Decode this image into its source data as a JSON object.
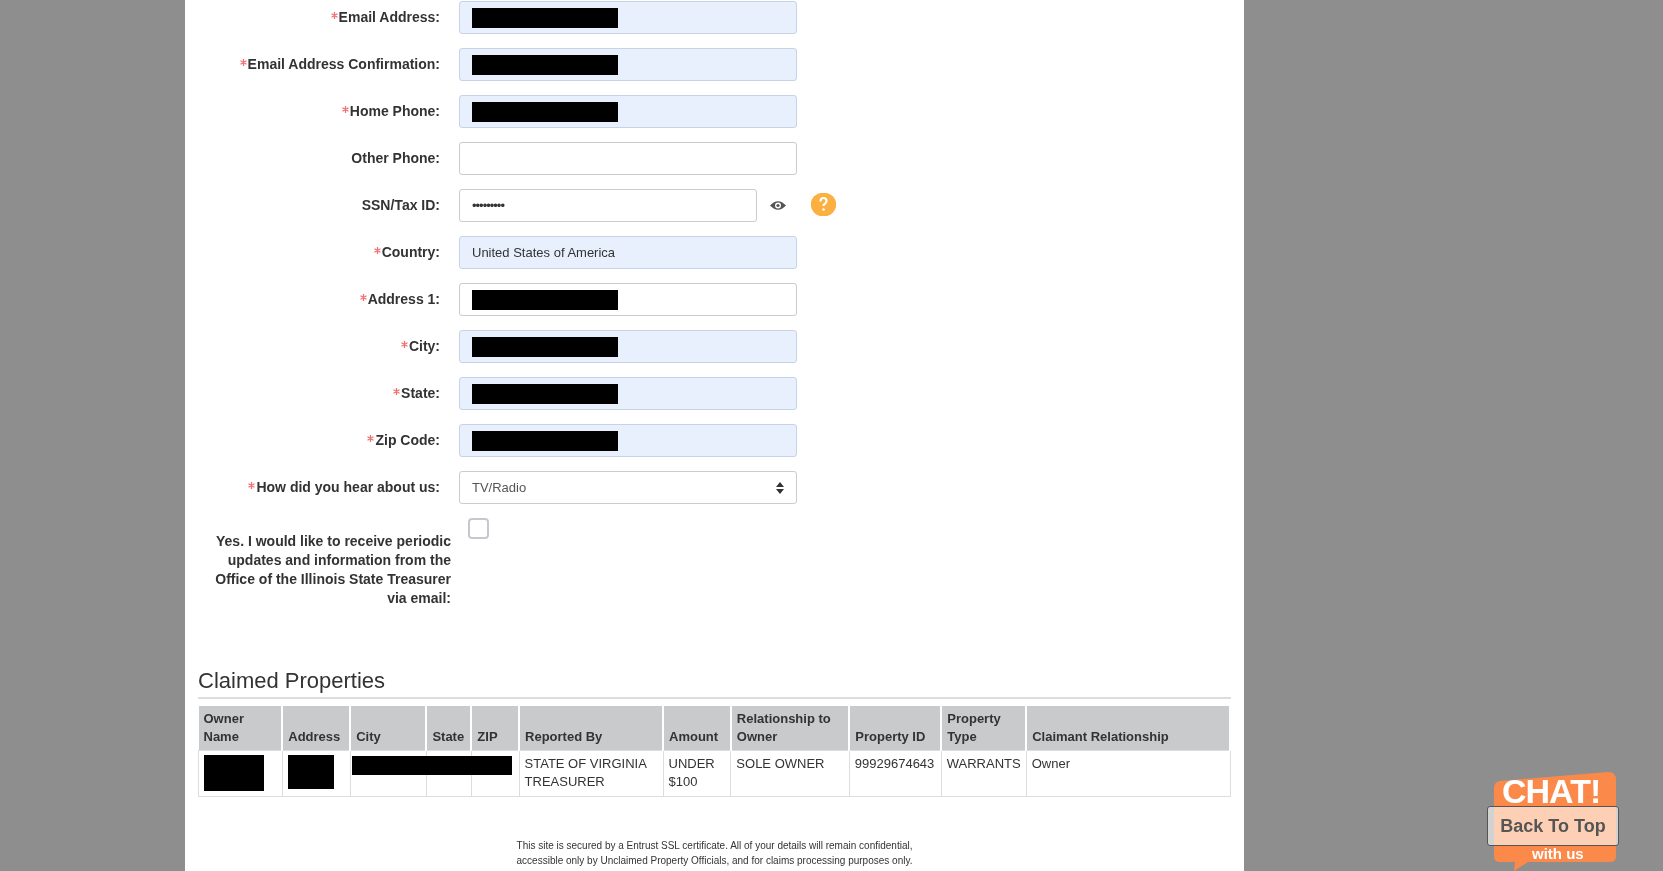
{
  "form": {
    "fields": [
      {
        "label": "Email Address:",
        "required": true,
        "kind": "text",
        "autofilled": true,
        "redacted": true
      },
      {
        "label": "Email Address Confirmation:",
        "required": true,
        "kind": "text",
        "autofilled": true,
        "redacted": true
      },
      {
        "label": "Home Phone:",
        "required": true,
        "kind": "text",
        "autofilled": true,
        "redacted": true
      },
      {
        "label": "Other Phone:",
        "required": false,
        "kind": "text",
        "autofilled": false,
        "redacted": false
      },
      {
        "label": "SSN/Tax ID:",
        "required": false,
        "kind": "password",
        "autofilled": false,
        "redacted": false,
        "value": "•••••••••"
      },
      {
        "label": "Country:",
        "required": true,
        "kind": "text",
        "autofilled": true,
        "redacted": false,
        "value": "United States of America"
      },
      {
        "label": "Address 1:",
        "required": true,
        "kind": "text",
        "autofilled": false,
        "redacted": true
      },
      {
        "label": "City:",
        "required": true,
        "kind": "text",
        "autofilled": true,
        "redacted": true
      },
      {
        "label": "State:",
        "required": true,
        "kind": "text",
        "autofilled": true,
        "redacted": true
      },
      {
        "label": "Zip Code:",
        "required": true,
        "kind": "text",
        "autofilled": true,
        "redacted": true
      },
      {
        "label": "How did you hear about us:",
        "required": true,
        "kind": "select",
        "autofilled": false,
        "value": "TV/Radio"
      },
      {
        "label": "Yes. I would like to receive periodic updates and information from the Office of the Illinois State Treasurer via email:",
        "kind": "checkbox",
        "checked": false
      }
    ]
  },
  "claimed_properties": {
    "title": "Claimed Properties",
    "columns": [
      "Owner Name",
      "Address",
      "City",
      "State",
      "ZIP",
      "Reported By",
      "Amount",
      "Relationship to Owner",
      "Property ID",
      "Property Type",
      "Claimant Relationship"
    ],
    "rows": [
      {
        "cells": [
          {
            "kind": "redacted"
          },
          {
            "kind": "redacted"
          },
          {
            "kind": "redacted"
          },
          {
            "kind": "blank"
          },
          {
            "kind": "blank"
          },
          {
            "kind": "text",
            "text": "STATE OF VIRGINIA TREASURER"
          },
          {
            "kind": "text",
            "text": "UNDER $100"
          },
          {
            "kind": "text",
            "text": "SOLE OWNER"
          },
          {
            "kind": "text",
            "text": "99929674643"
          },
          {
            "kind": "text",
            "text": "WARRANTS"
          },
          {
            "kind": "text",
            "text": "Owner"
          }
        ]
      }
    ]
  },
  "footer": {
    "lines": [
      "This site is secured by a Entrust SSL certificate. All of your details will remain confidential,",
      "accessible only by Unclaimed Property Officials, and for claims processing purposes only."
    ]
  },
  "chat_widget": {
    "title": "CHAT!",
    "subtitle": "with us"
  },
  "back_to_top": "Back To Top"
}
